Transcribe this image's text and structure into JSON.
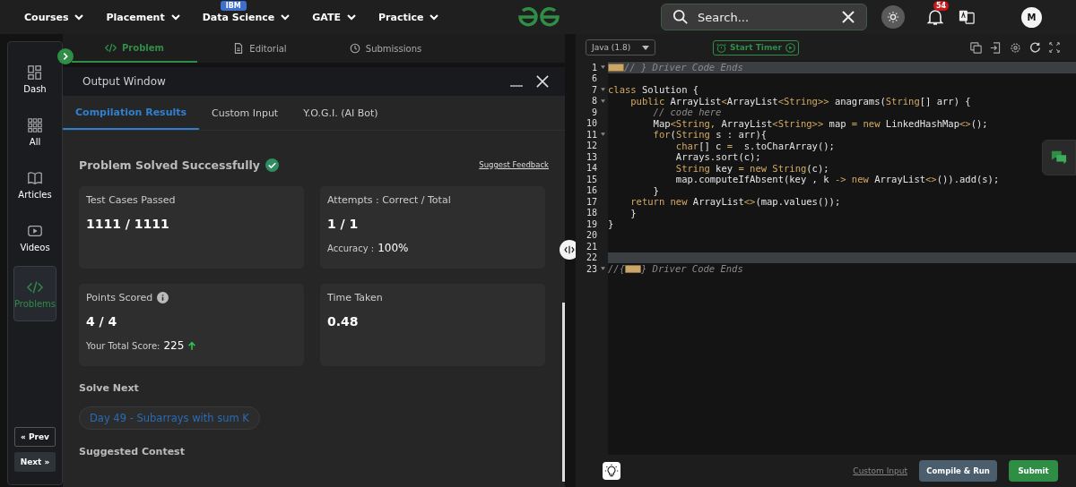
{
  "nav": {
    "items": [
      {
        "label": "Courses"
      },
      {
        "label": "Placement"
      },
      {
        "label": "Data Science",
        "badge": "IBM"
      },
      {
        "label": "GATE"
      },
      {
        "label": "Practice"
      }
    ],
    "search": {
      "placeholder": "Search..."
    },
    "notifications": "54",
    "avatar": "M"
  },
  "sidebar": {
    "items": [
      {
        "label": "Dash",
        "selected": false
      },
      {
        "label": "All",
        "selected": false
      },
      {
        "label": "Articles",
        "selected": false
      },
      {
        "label": "Videos",
        "selected": false
      },
      {
        "label": "Problems",
        "selected": true
      }
    ],
    "prev": "« Prev",
    "next": "Next »"
  },
  "problem_tabs": [
    {
      "label": "Problem",
      "selected": true
    },
    {
      "label": "Editorial",
      "selected": false
    },
    {
      "label": "Submissions",
      "selected": false
    }
  ],
  "output_window": {
    "title": "Output Window",
    "tabs": [
      {
        "label": "Compilation Results",
        "selected": true
      },
      {
        "label": "Custom Input",
        "selected": false
      },
      {
        "label": "Y.O.G.I. (AI Bot)",
        "selected": false
      }
    ],
    "status": "Problem Solved Successfully",
    "feedback": "Suggest Feedback",
    "cards": [
      {
        "title": "Test Cases Passed",
        "value": "1111 / 1111"
      },
      {
        "title": "Attempts : Correct / Total",
        "value": "1 / 1",
        "sub_label": "Accuracy :",
        "sub_value": "100%"
      },
      {
        "title": "Points Scored",
        "info": true,
        "value": "4 / 4",
        "sub_label": "Your Total Score:",
        "sub_value": "225",
        "trend_up": true
      },
      {
        "title": "Time Taken",
        "value": "0.48"
      }
    ],
    "solve_next_heading": "Solve Next",
    "solve_next": "Day 49 - Subarrays with sum K",
    "contest_heading": "Suggested Contest"
  },
  "editor": {
    "language": "Java (1.8)",
    "timer": "Start Timer",
    "lines": [
      {
        "number": "1",
        "fold": true,
        "highlight": true,
        "tokens": [
          {
            "kind": "fold"
          },
          {
            "kind": "comment",
            "text": "// } Driver Code Ends"
          }
        ]
      },
      {
        "number": "6",
        "fold": false,
        "highlight": false
      },
      {
        "number": "7",
        "fold": true,
        "highlight": false,
        "tokens": [
          {
            "kind": "keyword",
            "text": "class"
          },
          {
            "kind": "plain",
            "text": " Solution {"
          }
        ]
      },
      {
        "number": "8",
        "fold": true,
        "highlight": false,
        "tokens": [
          {
            "kind": "keyword",
            "text": "    public"
          },
          {
            "kind": "plain",
            "text": " ArrayList"
          },
          {
            "kind": "type",
            "text": "<"
          },
          {
            "kind": "plain",
            "text": "ArrayList"
          },
          {
            "kind": "type",
            "text": "<String>>"
          },
          {
            "kind": "plain",
            "text": " anagrams("
          },
          {
            "kind": "type",
            "text": "String"
          },
          {
            "kind": "plain",
            "text": "[] arr) {"
          }
        ]
      },
      {
        "number": "9",
        "fold": false,
        "highlight": false,
        "tokens": [
          {
            "kind": "comment",
            "text": "        // code here"
          }
        ]
      },
      {
        "number": "10",
        "fold": false,
        "highlight": false,
        "tokens": [
          {
            "kind": "plain",
            "text": "        Map"
          },
          {
            "kind": "type",
            "text": "<String,"
          },
          {
            "kind": "plain",
            "text": " ArrayList"
          },
          {
            "kind": "type",
            "text": "<String>>"
          },
          {
            "kind": "plain",
            "text": " map "
          },
          {
            "kind": "type",
            "text": "="
          },
          {
            "kind": "keyword",
            "text": " new"
          },
          {
            "kind": "plain",
            "text": " LinkedHashMap"
          },
          {
            "kind": "type",
            "text": "<>"
          },
          {
            "kind": "plain",
            "text": "();"
          }
        ]
      },
      {
        "number": "11",
        "fold": true,
        "highlight": false,
        "tokens": [
          {
            "kind": "keyword",
            "text": "        for"
          },
          {
            "kind": "plain",
            "text": "("
          },
          {
            "kind": "type",
            "text": "String"
          },
          {
            "kind": "plain",
            "text": " s : arr){"
          }
        ]
      },
      {
        "number": "12",
        "fold": false,
        "highlight": false,
        "tokens": [
          {
            "kind": "keyword",
            "text": "            char"
          },
          {
            "kind": "plain",
            "text": "[] c "
          },
          {
            "kind": "type",
            "text": "="
          },
          {
            "kind": "plain",
            "text": "  s.toCharArray();"
          }
        ]
      },
      {
        "number": "13",
        "fold": false,
        "highlight": false,
        "tokens": [
          {
            "kind": "plain",
            "text": "            Arrays.sort(c);"
          }
        ]
      },
      {
        "number": "14",
        "fold": false,
        "highlight": false,
        "tokens": [
          {
            "kind": "type",
            "text": "            String"
          },
          {
            "kind": "plain",
            "text": " key "
          },
          {
            "kind": "type",
            "text": "="
          },
          {
            "kind": "keyword",
            "text": " new"
          },
          {
            "kind": "type",
            "text": " String"
          },
          {
            "kind": "plain",
            "text": "(c);"
          }
        ]
      },
      {
        "number": "15",
        "fold": false,
        "highlight": false,
        "tokens": [
          {
            "kind": "plain",
            "text": "            map.computeIfAbsent(key , k "
          },
          {
            "kind": "type",
            "text": "->"
          },
          {
            "kind": "keyword",
            "text": " new"
          },
          {
            "kind": "plain",
            "text": " ArrayList"
          },
          {
            "kind": "type",
            "text": "<>"
          },
          {
            "kind": "plain",
            "text": "()).add(s);"
          }
        ]
      },
      {
        "number": "16",
        "fold": false,
        "highlight": false,
        "tokens": [
          {
            "kind": "plain",
            "text": "        }"
          }
        ]
      },
      {
        "number": "17",
        "fold": false,
        "highlight": false,
        "tokens": [
          {
            "kind": "keyword",
            "text": "    return"
          },
          {
            "kind": "keyword",
            "text": " new"
          },
          {
            "kind": "plain",
            "text": " ArrayList"
          },
          {
            "kind": "type",
            "text": "<>"
          },
          {
            "kind": "plain",
            "text": "(map.values());"
          }
        ]
      },
      {
        "number": "18",
        "fold": false,
        "highlight": false,
        "tokens": [
          {
            "kind": "plain",
            "text": "    }"
          }
        ]
      },
      {
        "number": "19",
        "fold": false,
        "highlight": false,
        "tokens": [
          {
            "kind": "plain",
            "text": "}"
          }
        ]
      },
      {
        "number": "20",
        "fold": false,
        "highlight": false
      },
      {
        "number": "21",
        "fold": false,
        "highlight": false
      },
      {
        "number": "22",
        "fold": false,
        "highlight": true
      },
      {
        "number": "23",
        "fold": true,
        "highlight": false,
        "tokens": [
          {
            "kind": "comment",
            "text": "//{"
          },
          {
            "kind": "fold"
          },
          {
            "kind": "comment",
            "text": "} Driver Code Ends"
          }
        ]
      }
    ],
    "custom_input": "Custom Input",
    "compile": "Compile & Run",
    "submit": "Submit"
  }
}
